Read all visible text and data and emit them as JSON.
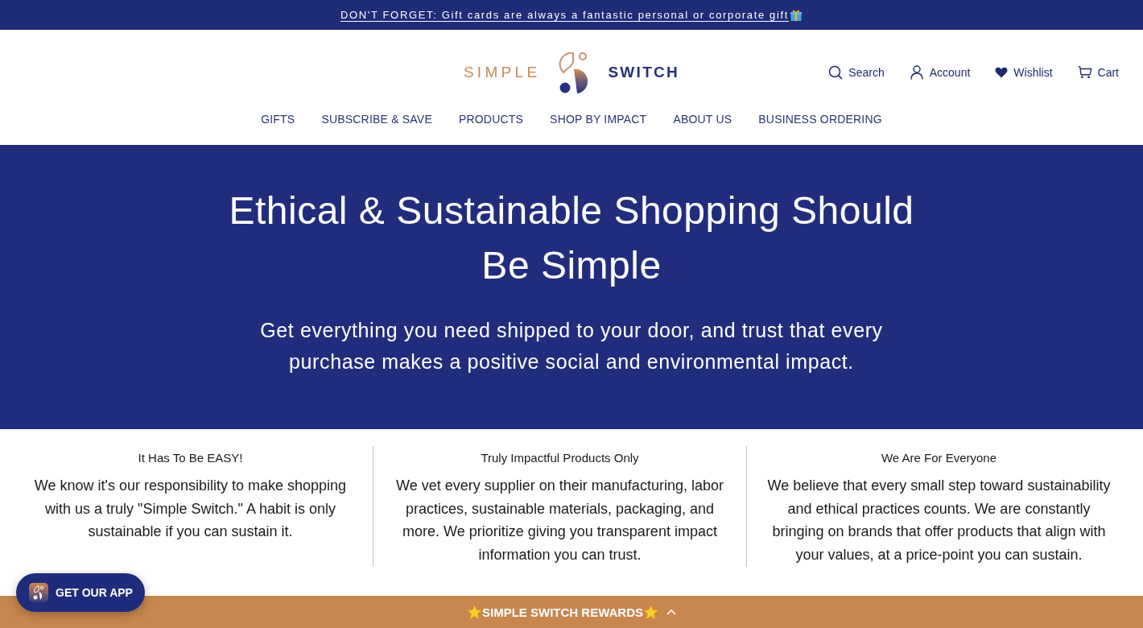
{
  "announcement": {
    "text": "DON'T FORGET: Gift cards are always a fantastic personal or corporate gift"
  },
  "header": {
    "logo": {
      "left": "SIMPLE",
      "right": "SWITCH"
    },
    "actions": [
      {
        "kind": "search",
        "label": "Search"
      },
      {
        "kind": "account",
        "label": "Account"
      },
      {
        "kind": "wishlist",
        "label": "Wishlist"
      },
      {
        "kind": "cart",
        "label": "Cart"
      }
    ]
  },
  "nav": [
    "GIFTS",
    "SUBSCRIBE & SAVE",
    "PRODUCTS",
    "SHOP BY IMPACT",
    "ABOUT US",
    "BUSINESS ORDERING"
  ],
  "hero": {
    "title": "Ethical & Sustainable Shopping Should Be Simple",
    "subtitle": "Get everything you need shipped to your door, and trust that every purchase makes a positive social and environmental impact."
  },
  "features": [
    {
      "heading": "It Has To Be EASY!",
      "body": "We know it's our responsibility to make shopping with us a truly \"Simple Switch.\" A habit is only sustainable if you can sustain it."
    },
    {
      "heading": "Truly Impactful Products Only",
      "body": "We vet every supplier on their manufacturing, labor practices, sustainable materials, packaging, and more. We prioritize giving you transparent impact information you can trust."
    },
    {
      "heading": "We Are For Everyone",
      "body": "We believe that every small step toward sustainability and ethical practices counts. We are constantly bringing on brands that offer products that align with your values, at a price-point you can sustain."
    }
  ],
  "app_button": {
    "label": "GET OUR APP"
  },
  "rewards_bar": {
    "label": "SIMPLE SWITCH REWARDS"
  }
}
